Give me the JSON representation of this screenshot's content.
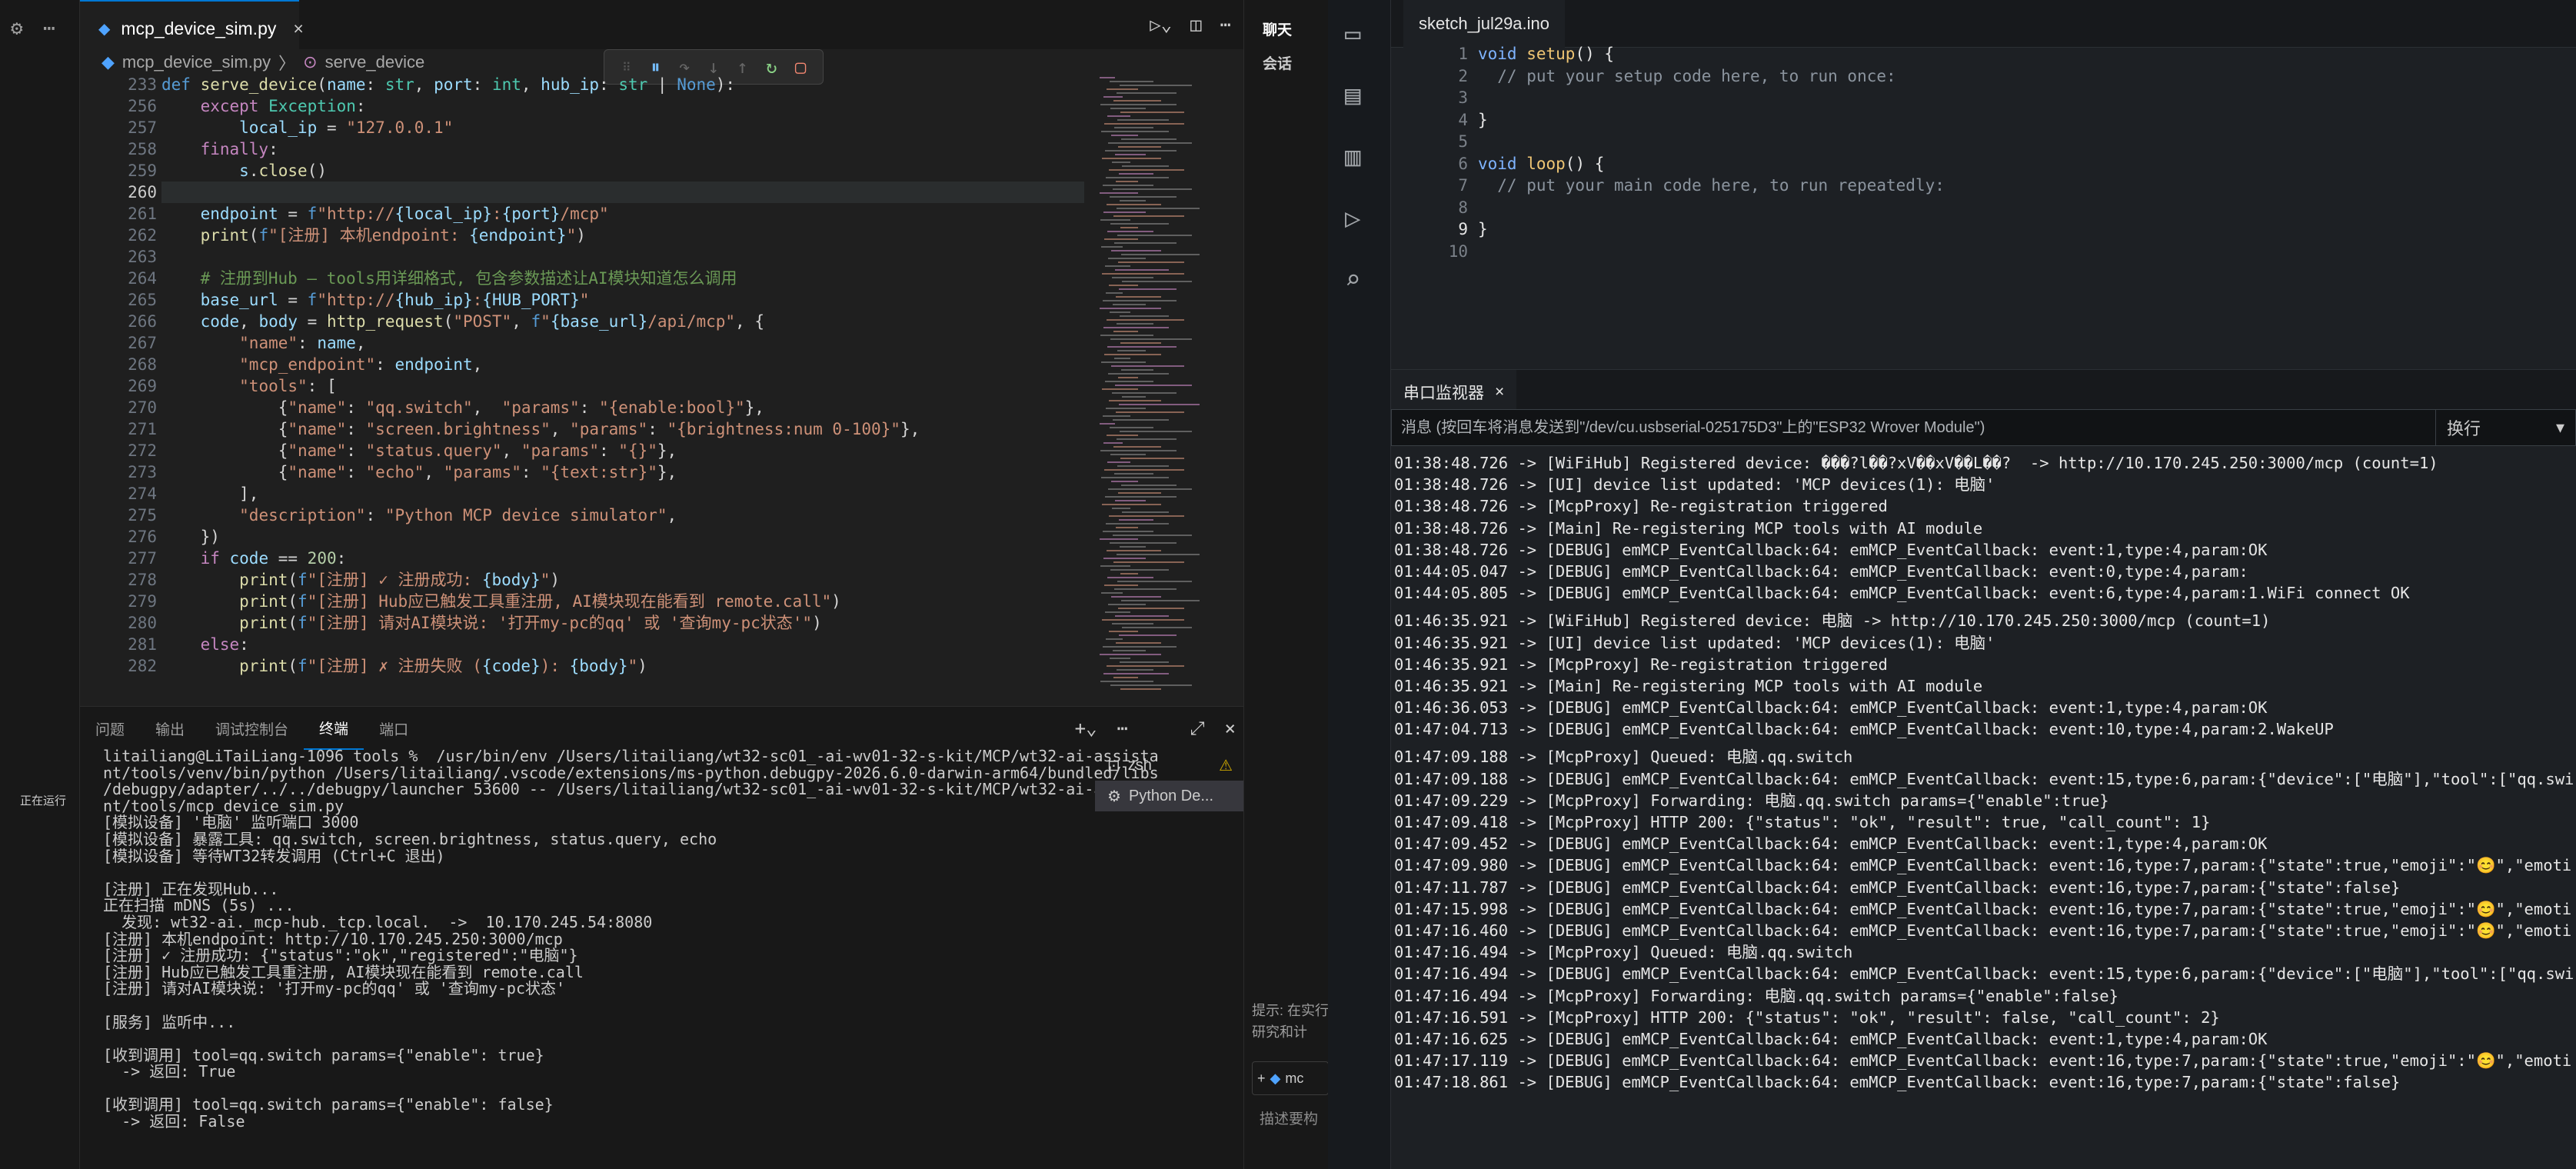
{
  "vscode": {
    "tab": {
      "filename": "mcp_device_sim.py",
      "close": "×"
    },
    "breadcrumb": {
      "file": "mcp_device_sim.py",
      "sep": "〉",
      "symbol": "serve_device"
    },
    "sidebar_status": "正在运行",
    "line_numbers": [
      "233",
      "256",
      "257",
      "258",
      "259",
      "260",
      "261",
      "262",
      "263",
      "264",
      "265",
      "266",
      "267",
      "268",
      "269",
      "270",
      "271",
      "272",
      "273",
      "274",
      "275",
      "276",
      "277",
      "278",
      "279",
      "280",
      "281",
      "282"
    ],
    "code_lines": [
      [
        [
          "def ",
          "d"
        ],
        [
          "serve_device",
          "f"
        ],
        [
          "(",
          "w"
        ],
        [
          "name",
          "p"
        ],
        [
          ": ",
          "w"
        ],
        [
          "str",
          "t"
        ],
        [
          ", ",
          "w"
        ],
        [
          "port",
          "p"
        ],
        [
          ": ",
          "w"
        ],
        [
          "int",
          "t"
        ],
        [
          ", ",
          "w"
        ],
        [
          "hub_ip",
          "p"
        ],
        [
          ": ",
          "w"
        ],
        [
          "str",
          "t"
        ],
        [
          " | ",
          "w"
        ],
        [
          "None",
          "d"
        ],
        [
          "):",
          "w"
        ]
      ],
      [
        [
          "    ",
          "w"
        ],
        [
          "except ",
          "k"
        ],
        [
          "Exception",
          "t"
        ],
        [
          ":",
          "w"
        ]
      ],
      [
        [
          "        ",
          "w"
        ],
        [
          "local_ip",
          "p"
        ],
        [
          " = ",
          "w"
        ],
        [
          "\"127.0.0.1\"",
          "s"
        ]
      ],
      [
        [
          "    ",
          "w"
        ],
        [
          "finally",
          "k"
        ],
        [
          ":",
          "w"
        ]
      ],
      [
        [
          "        ",
          "w"
        ],
        [
          "s",
          "p"
        ],
        [
          ".",
          "w"
        ],
        [
          "close",
          "f"
        ],
        [
          "()",
          "w"
        ]
      ],
      [
        [
          "",
          "w"
        ]
      ],
      [
        [
          "    ",
          "w"
        ],
        [
          "endpoint",
          "p"
        ],
        [
          " = ",
          "w"
        ],
        [
          "f",
          "d"
        ],
        [
          "\"http://",
          "s"
        ],
        [
          "{local_ip}",
          "p"
        ],
        [
          ":",
          "s"
        ],
        [
          "{port}",
          "p"
        ],
        [
          "/mcp\"",
          "s"
        ]
      ],
      [
        [
          "    ",
          "w"
        ],
        [
          "print",
          "f"
        ],
        [
          "(",
          "w"
        ],
        [
          "f",
          "d"
        ],
        [
          "\"[注册] 本机endpoint: ",
          "s"
        ],
        [
          "{endpoint}",
          "p"
        ],
        [
          "\"",
          "s"
        ],
        [
          ")",
          "w"
        ]
      ],
      [
        [
          "",
          "w"
        ]
      ],
      [
        [
          "    ",
          "w"
        ],
        [
          "# 注册到Hub — tools用详细格式, 包含参数描述让AI模块知道怎么调用",
          "c"
        ]
      ],
      [
        [
          "    ",
          "w"
        ],
        [
          "base_url",
          "p"
        ],
        [
          " = ",
          "w"
        ],
        [
          "f",
          "d"
        ],
        [
          "\"http://",
          "s"
        ],
        [
          "{hub_ip}",
          "p"
        ],
        [
          ":",
          "s"
        ],
        [
          "{HUB_PORT}",
          "p"
        ],
        [
          "\"",
          "s"
        ]
      ],
      [
        [
          "    ",
          "w"
        ],
        [
          "code",
          "p"
        ],
        [
          ", ",
          "w"
        ],
        [
          "body",
          "p"
        ],
        [
          " = ",
          "w"
        ],
        [
          "http_request",
          "f"
        ],
        [
          "(",
          "w"
        ],
        [
          "\"POST\"",
          "s"
        ],
        [
          ", ",
          "w"
        ],
        [
          "f",
          "d"
        ],
        [
          "\"",
          "s"
        ],
        [
          "{base_url}",
          "p"
        ],
        [
          "/api/mcp\"",
          "s"
        ],
        [
          ", {",
          "w"
        ]
      ],
      [
        [
          "        ",
          "w"
        ],
        [
          "\"name\"",
          "s"
        ],
        [
          ": ",
          "w"
        ],
        [
          "name",
          "p"
        ],
        [
          ",",
          "w"
        ]
      ],
      [
        [
          "        ",
          "w"
        ],
        [
          "\"mcp_endpoint\"",
          "s"
        ],
        [
          ": ",
          "w"
        ],
        [
          "endpoint",
          "p"
        ],
        [
          ",",
          "w"
        ]
      ],
      [
        [
          "        ",
          "w"
        ],
        [
          "\"tools\"",
          "s"
        ],
        [
          ": [",
          "w"
        ]
      ],
      [
        [
          "            {",
          "w"
        ],
        [
          "\"name\"",
          "s"
        ],
        [
          ": ",
          "w"
        ],
        [
          "\"qq.switch\"",
          "s"
        ],
        [
          ",  ",
          "w"
        ],
        [
          "\"params\"",
          "s"
        ],
        [
          ": ",
          "w"
        ],
        [
          "\"{enable:bool}\"",
          "s"
        ],
        [
          "},",
          "w"
        ]
      ],
      [
        [
          "            {",
          "w"
        ],
        [
          "\"name\"",
          "s"
        ],
        [
          ": ",
          "w"
        ],
        [
          "\"screen.brightness\"",
          "s"
        ],
        [
          ", ",
          "w"
        ],
        [
          "\"params\"",
          "s"
        ],
        [
          ": ",
          "w"
        ],
        [
          "\"{brightness:num 0-100}\"",
          "s"
        ],
        [
          "},",
          "w"
        ]
      ],
      [
        [
          "            {",
          "w"
        ],
        [
          "\"name\"",
          "s"
        ],
        [
          ": ",
          "w"
        ],
        [
          "\"status.query\"",
          "s"
        ],
        [
          ", ",
          "w"
        ],
        [
          "\"params\"",
          "s"
        ],
        [
          ": ",
          "w"
        ],
        [
          "\"{}\"",
          "s"
        ],
        [
          "},",
          "w"
        ]
      ],
      [
        [
          "            {",
          "w"
        ],
        [
          "\"name\"",
          "s"
        ],
        [
          ": ",
          "w"
        ],
        [
          "\"echo\"",
          "s"
        ],
        [
          ", ",
          "w"
        ],
        [
          "\"params\"",
          "s"
        ],
        [
          ": ",
          "w"
        ],
        [
          "\"{text:str}\"",
          "s"
        ],
        [
          "},",
          "w"
        ]
      ],
      [
        [
          "        ],",
          "w"
        ]
      ],
      [
        [
          "        ",
          "w"
        ],
        [
          "\"description\"",
          "s"
        ],
        [
          ": ",
          "w"
        ],
        [
          "\"Python MCP device simulator\"",
          "s"
        ],
        [
          ",",
          "w"
        ]
      ],
      [
        [
          "    })",
          "w"
        ]
      ],
      [
        [
          "    ",
          "w"
        ],
        [
          "if ",
          "k"
        ],
        [
          "code",
          "p"
        ],
        [
          " == ",
          "w"
        ],
        [
          "200",
          "n"
        ],
        [
          ":",
          "w"
        ]
      ],
      [
        [
          "        ",
          "w"
        ],
        [
          "print",
          "f"
        ],
        [
          "(",
          "w"
        ],
        [
          "f",
          "d"
        ],
        [
          "\"[注册] ✓ 注册成功: ",
          "s"
        ],
        [
          "{body}",
          "p"
        ],
        [
          "\"",
          "s"
        ],
        [
          ")",
          "w"
        ]
      ],
      [
        [
          "        ",
          "w"
        ],
        [
          "print",
          "f"
        ],
        [
          "(",
          "w"
        ],
        [
          "f",
          "d"
        ],
        [
          "\"[注册] Hub应已触发工具重注册, AI模块现在能看到 remote.call\"",
          "s"
        ],
        [
          ")",
          "w"
        ]
      ],
      [
        [
          "        ",
          "w"
        ],
        [
          "print",
          "f"
        ],
        [
          "(",
          "w"
        ],
        [
          "f",
          "d"
        ],
        [
          "\"[注册] 请对AI模块说: '打开my-pc的qq' 或 '查询my-pc状态'\"",
          "s"
        ],
        [
          ")",
          "w"
        ]
      ],
      [
        [
          "    ",
          "w"
        ],
        [
          "else",
          "k"
        ],
        [
          ":",
          "w"
        ]
      ],
      [
        [
          "        ",
          "w"
        ],
        [
          "print",
          "f"
        ],
        [
          "(",
          "w"
        ],
        [
          "f",
          "d"
        ],
        [
          "\"[注册] ✗ 注册失败 (",
          "s"
        ],
        [
          "{code}",
          "p"
        ],
        [
          "): ",
          "s"
        ],
        [
          "{body}",
          "p"
        ],
        [
          "\"",
          "s"
        ],
        [
          ")",
          "w"
        ]
      ]
    ],
    "panel_tabs": [
      "问题",
      "输出",
      "调试控制台",
      "终端",
      "端口"
    ],
    "panel_active": "终端",
    "terminal_list": [
      "zsh",
      "Python De..."
    ],
    "terminal_lines": [
      "litailiang@LiTaiLiang-1096 tools %  /usr/bin/env /Users/litailiang/wt32-sc01_-ai-wv01-32-s-kit/MCP/wt32-ai-assista",
      "nt/tools/venv/bin/python /Users/litailiang/.vscode/extensions/ms-python.debugpy-2026.6.0-darwin-arm64/bundled/libs",
      "/debugpy/adapter/../../debugpy/launcher 53600 -- /Users/litailiang/wt32-sc01_-ai-wv01-32-s-kit/MCP/wt32-ai-assista",
      "nt/tools/mcp_device_sim.py",
      "[模拟设备] '电脑' 监听端口 3000",
      "[模拟设备] 暴露工具: qq.switch, screen.brightness, status.query, echo",
      "[模拟设备] 等待WT32转发调用 (Ctrl+C 退出)",
      "",
      "[注册] 正在发现Hub...",
      "正在扫描 mDNS (5s) ...",
      "  发现: wt32-ai._mcp-hub._tcp.local.  ->  10.170.245.54:8080",
      "[注册] 本机endpoint: http://10.170.245.250:3000/mcp",
      "[注册] ✓ 注册成功: {\"status\":\"ok\",\"registered\":\"电脑\"}",
      "[注册] Hub应已触发工具重注册, AI模块现在能看到 remote.call",
      "[注册] 请对AI模块说: '打开my-pc的qq' 或 '查询my-pc状态'",
      "",
      "[服务] 监听中...",
      "",
      "[收到调用] tool=qq.switch params={\"enable\": true}",
      "  -> 返回: True",
      "",
      "[收到调用] tool=qq.switch params={\"enable\": false}",
      "  -> 返回: False"
    ]
  },
  "chat": {
    "title": "聊天",
    "item": "会话",
    "hint": "提示: 在实行研究和计",
    "hint2": "描述要构",
    "chip": "mc"
  },
  "arduino": {
    "sketch_tab": "sketch_jul29a.ino",
    "line_numbers": [
      "1",
      "2",
      "3",
      "4",
      "5",
      "6",
      "7",
      "8",
      "9",
      "10"
    ],
    "code_lines": [
      [
        [
          "void ",
          "ak"
        ],
        [
          "setup",
          "af"
        ],
        [
          "() {",
          "w"
        ]
      ],
      [
        [
          "  // put your setup code here, to run once:",
          "ac"
        ]
      ],
      [
        [
          "",
          "w"
        ]
      ],
      [
        [
          "}",
          "w"
        ]
      ],
      [
        [
          "",
          "w"
        ]
      ],
      [
        [
          "void ",
          "ak"
        ],
        [
          "loop",
          "af"
        ],
        [
          "() {",
          "w"
        ]
      ],
      [
        [
          "  // put your main code here, to run repeatedly:",
          "ac"
        ]
      ],
      [
        [
          "",
          "w"
        ]
      ],
      [
        [
          "}",
          "w"
        ]
      ],
      [
        [
          "",
          "w"
        ]
      ]
    ],
    "serial_title": "串口监视器",
    "serial_placeholder": "消息 (按回车将消息发送到\"/dev/cu.usbserial-025175D3\"上的\"ESP32 Wrover Module\")",
    "line_ending": "换行",
    "serial_lines": [
      "01:38:48.726 -> [WiFiHub] Registered device: ���?l��?xV��xV��L��?  -> http://10.170.245.250:3000/mcp (count=1)",
      "01:38:48.726 -> [UI] device list updated: 'MCP devices(1): 电脑'",
      "01:38:48.726 -> [McpProxy] Re-registration triggered",
      "01:38:48.726 -> [Main] Re-registering MCP tools with AI module",
      "01:38:48.726 -> [DEBUG] emMCP_EventCallback:64: emMCP_EventCallback: event:1,type:4,param:OK",
      "01:44:05.047 -> [DEBUG] emMCP_EventCallback:64: emMCP_EventCallback: event:0,type:4,param:",
      "01:44:05.805 -> [DEBUG] emMCP_EventCallback:64: emMCP_EventCallback: event:6,type:4,param:1.WiFi connect OK",
      "",
      "01:46:35.921 -> [WiFiHub] Registered device: 电脑 -> http://10.170.245.250:3000/mcp (count=1)",
      "01:46:35.921 -> [UI] device list updated: 'MCP devices(1): 电脑'",
      "01:46:35.921 -> [McpProxy] Re-registration triggered",
      "01:46:35.921 -> [Main] Re-registering MCP tools with AI module",
      "01:46:36.053 -> [DEBUG] emMCP_EventCallback:64: emMCP_EventCallback: event:1,type:4,param:OK",
      "01:47:04.713 -> [DEBUG] emMCP_EventCallback:64: emMCP_EventCallback: event:10,type:4,param:2.WakeUP",
      "",
      "01:47:09.188 -> [McpProxy] Queued: 电脑.qq.switch",
      "01:47:09.188 -> [DEBUG] emMCP_EventCallback:64: emMCP_EventCallback: event:15,type:6,param:{\"device\":[\"电脑\"],\"tool\":[\"qq.swi",
      "01:47:09.229 -> [McpProxy] Forwarding: 电脑.qq.switch params={\"enable\":true}",
      "01:47:09.418 -> [McpProxy] HTTP 200: {\"status\": \"ok\", \"result\": true, \"call_count\": 1}",
      "01:47:09.452 -> [DEBUG] emMCP_EventCallback:64: emMCP_EventCallback: event:1,type:4,param:OK",
      "01:47:09.980 -> [DEBUG] emMCP_EventCallback:64: emMCP_EventCallback: event:16,type:7,param:{\"state\":true,\"emoji\":\"😊\",\"emoti",
      "01:47:11.787 -> [DEBUG] emMCP_EventCallback:64: emMCP_EventCallback: event:16,type:7,param:{\"state\":false}",
      "01:47:15.998 -> [DEBUG] emMCP_EventCallback:64: emMCP_EventCallback: event:16,type:7,param:{\"state\":true,\"emoji\":\"😊\",\"emoti",
      "01:47:16.460 -> [DEBUG] emMCP_EventCallback:64: emMCP_EventCallback: event:16,type:7,param:{\"state\":true,\"emoji\":\"😊\",\"emoti",
      "01:47:16.494 -> [McpProxy] Queued: 电脑.qq.switch",
      "01:47:16.494 -> [DEBUG] emMCP_EventCallback:64: emMCP_EventCallback: event:15,type:6,param:{\"device\":[\"电脑\"],\"tool\":[\"qq.swi",
      "01:47:16.494 -> [McpProxy] Forwarding: 电脑.qq.switch params={\"enable\":false}",
      "01:47:16.591 -> [McpProxy] HTTP 200: {\"status\": \"ok\", \"result\": false, \"call_count\": 2}",
      "01:47:16.625 -> [DEBUG] emMCP_EventCallback:64: emMCP_EventCallback: event:1,type:4,param:OK",
      "01:47:17.119 -> [DEBUG] emMCP_EventCallback:64: emMCP_EventCallback: event:16,type:7,param:{\"state\":true,\"emoji\":\"😊\",\"emoti",
      "01:47:18.861 -> [DEBUG] emMCP_EventCallback:64: emMCP_EventCallback: event:16,type:7,param:{\"state\":false}"
    ]
  }
}
